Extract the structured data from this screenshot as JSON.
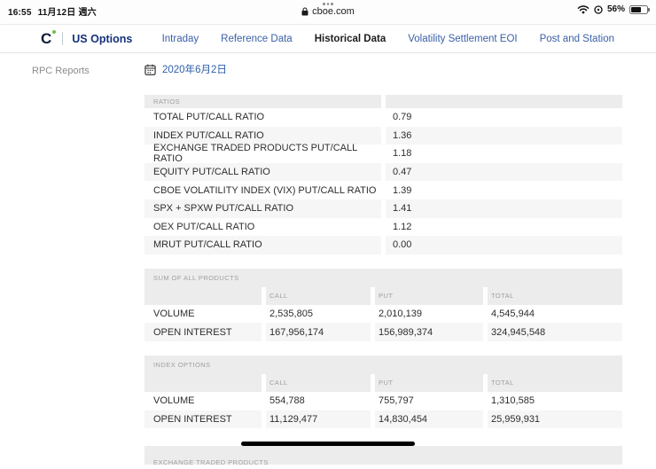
{
  "status_bar": {
    "time": "16:55",
    "date": "11月12日 週六",
    "battery": "56%"
  },
  "browser": {
    "url": "cboe.com"
  },
  "nav": {
    "logo_letter": "C",
    "brand": "US Options",
    "links": [
      {
        "label": "Intraday",
        "active": false
      },
      {
        "label": "Reference Data",
        "active": false
      },
      {
        "label": "Historical Data",
        "active": true
      },
      {
        "label": "Volatility Settlement EOI",
        "active": false
      },
      {
        "label": "Post and Station",
        "active": false
      }
    ]
  },
  "sidebar": {
    "items": [
      {
        "label": "RPC Reports"
      }
    ]
  },
  "main": {
    "date_value": "2020年6月2日",
    "ratios": {
      "title": "RATIOS",
      "rows": [
        {
          "label": "TOTAL PUT/CALL RATIO",
          "value": "0.79"
        },
        {
          "label": "INDEX PUT/CALL RATIO",
          "value": "1.36"
        },
        {
          "label": "EXCHANGE TRADED PRODUCTS PUT/CALL RATIO",
          "value": "1.18"
        },
        {
          "label": "EQUITY PUT/CALL RATIO",
          "value": "0.47"
        },
        {
          "label": "CBOE VOLATILITY INDEX (VIX) PUT/CALL RATIO",
          "value": "1.39"
        },
        {
          "label": "SPX + SPXW PUT/CALL RATIO",
          "value": "1.41"
        },
        {
          "label": "OEX PUT/CALL RATIO",
          "value": "1.12"
        },
        {
          "label": "MRUT PUT/CALL RATIO",
          "value": "0.00"
        }
      ]
    },
    "product_tables": [
      {
        "title": "SUM OF ALL PRODUCTS",
        "columns": [
          "CALL",
          "PUT",
          "TOTAL"
        ],
        "rows": [
          {
            "label": "VOLUME",
            "values": [
              "2,535,805",
              "2,010,139",
              "4,545,944"
            ]
          },
          {
            "label": "OPEN INTEREST",
            "values": [
              "167,956,174",
              "156,989,374",
              "324,945,548"
            ]
          }
        ]
      },
      {
        "title": "INDEX OPTIONS",
        "columns": [
          "CALL",
          "PUT",
          "TOTAL"
        ],
        "rows": [
          {
            "label": "VOLUME",
            "values": [
              "554,788",
              "755,797",
              "1,310,585"
            ]
          },
          {
            "label": "OPEN INTEREST",
            "values": [
              "11,129,477",
              "14,830,454",
              "25,959,931"
            ]
          }
        ]
      }
    ],
    "partial_table_title": "EXCHANGE TRADED PRODUCTS"
  },
  "colors": {
    "link_blue": "#2e5faa",
    "brand_navy": "#14317d",
    "logo_green": "#6cc04a",
    "header_gray": "#ececec",
    "stripe_gray": "#f6f6f6"
  }
}
